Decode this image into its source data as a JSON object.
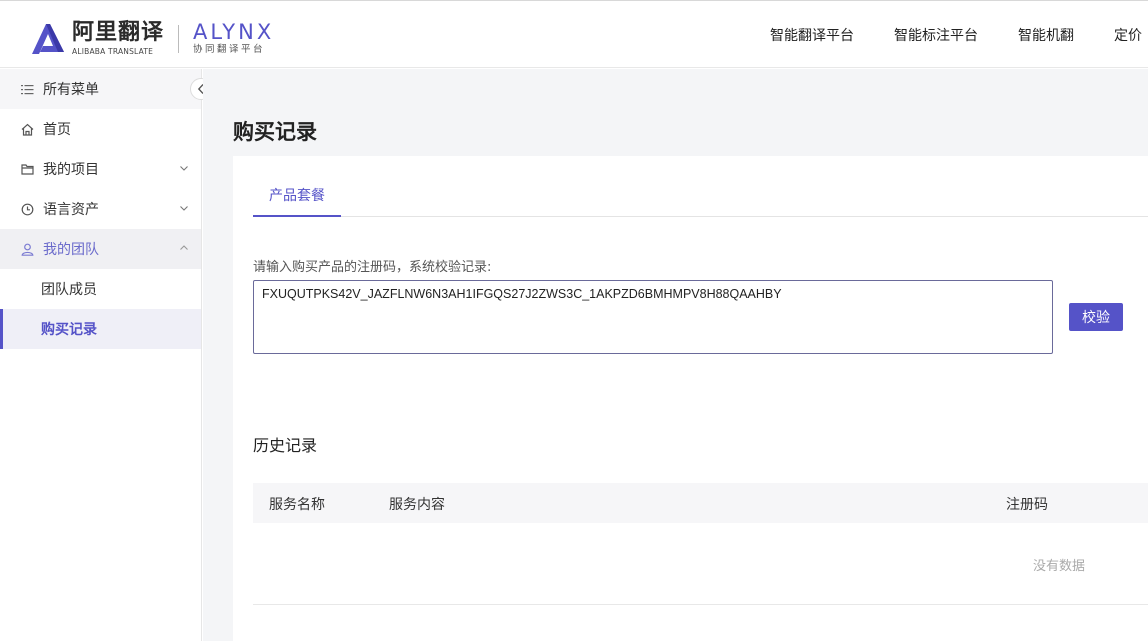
{
  "header": {
    "brand_cn": "阿里翻译",
    "brand_en": "ALIBABA TRANSLATE",
    "alynx": "ALYNX",
    "alynx_sub": "协同翻译平台",
    "nav": [
      "智能翻译平台",
      "智能标注平台",
      "智能机翻",
      "定价"
    ]
  },
  "sidebar": {
    "all_menu": "所有菜单",
    "home": "首页",
    "my_projects": "我的项目",
    "language_assets": "语言资产",
    "my_team": "我的团队",
    "team_members": "团队成员",
    "purchase_records": "购买记录"
  },
  "main": {
    "title": "购买记录",
    "tab_label": "产品套餐",
    "prompt": "请输入购买产品的注册码，系统校验记录:",
    "code_value": "FXUQUTPKS42V_JAZFLNW6N3AH1IFGQS27J2ZWS3C_1AKPZD6BMHMPV8H88QAAHBY",
    "verify_label": "校验",
    "history_title": "历史记录",
    "columns": [
      "服务名称",
      "服务内容",
      "注册码"
    ],
    "empty_text": "没有数据"
  },
  "colors": {
    "accent": "#5553c8"
  }
}
